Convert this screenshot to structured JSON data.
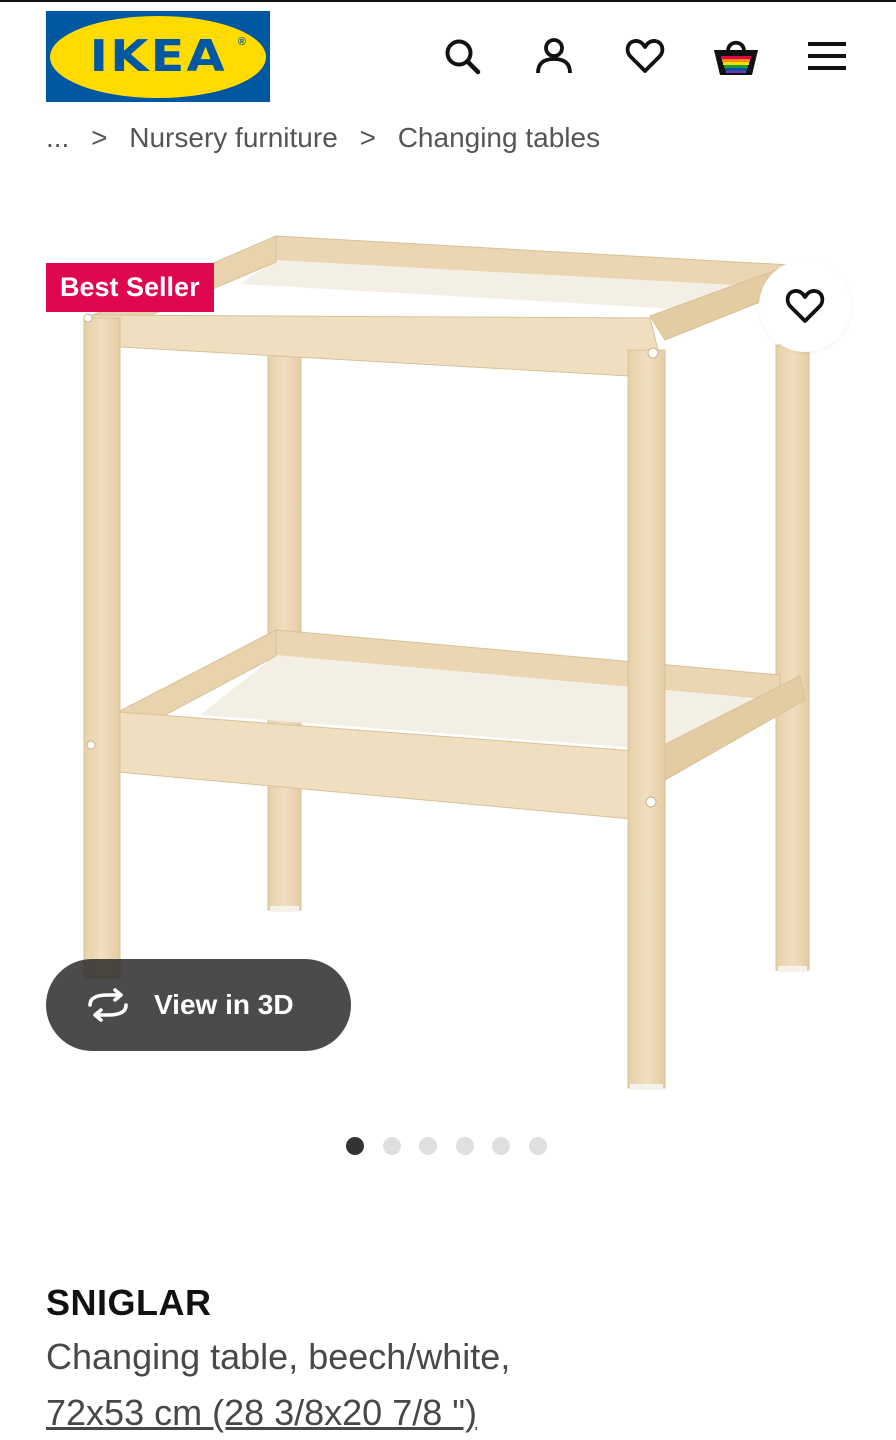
{
  "header": {
    "logo_text": "IKEA",
    "logo_reg": "®",
    "icons": [
      "search-icon",
      "account-icon",
      "heart-icon",
      "shopping-bag-icon",
      "menu-icon"
    ]
  },
  "breadcrumb": {
    "items": [
      "...",
      "Nursery furniture",
      "Changing tables"
    ],
    "separator": ">"
  },
  "gallery": {
    "badge": "Best Seller",
    "view_3d_label": "View in 3D",
    "image_count": 6,
    "active_image": 1
  },
  "product": {
    "name": "SNIGLAR",
    "description": "Changing table, beech/white,",
    "size": "72x53 cm (28 3/8x20 7/8 \")"
  },
  "colors": {
    "ikea_blue": "#0058a3",
    "ikea_yellow": "#ffdb00",
    "badge_red": "#e00751",
    "beech": "#ecd9b8",
    "panel_white": "#f4efe4"
  }
}
